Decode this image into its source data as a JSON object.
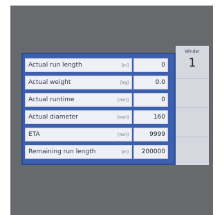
{
  "side_panel": {
    "title": "Winder",
    "number": "1"
  },
  "rows": [
    {
      "label": "Actual run length",
      "unit": "[m]",
      "value": "0"
    },
    {
      "label": "Actual weight",
      "unit": "[kg]",
      "value": "0.0"
    },
    {
      "label": "Actual runtime",
      "unit": "[min]",
      "value": "0"
    },
    {
      "label": "Actual diameter",
      "unit": "[mm]",
      "value": "160"
    },
    {
      "label": "ETA",
      "unit": "[min]",
      "value": "9999"
    },
    {
      "label": "Remaining run length",
      "unit": "[m]",
      "value": "200000"
    }
  ],
  "colors": {
    "panel_blue": "#3c5fae",
    "screen_gray": "#666a6c",
    "side_gray": "#d5d8df"
  }
}
